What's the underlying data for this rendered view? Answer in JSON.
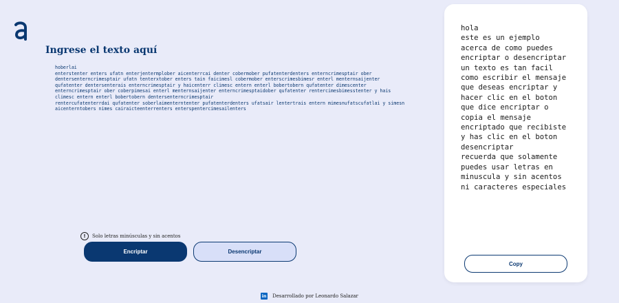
{
  "header": {
    "title": "Ingrese el texto aquí"
  },
  "input": {
    "value": "hoberlai\nenterstenter enters ufatn enterjentermplober aicenterrcai denter cobermober pufatenterdenters enterncrimesptair ober dentersenterncrimesptair ufatn tenterxtober enters tain faicimesl cobermober enterscrimesbimesr enterl menternsaijenter qufatenter dentersenterais enterncrimesptair y haicenterr climesc entern enterl bobertobern qufatenter dimescenter enterncrimesptair ober coberpimesai enterl menternsaijenter enterncrimesptaidober qufatenter rentercimesbimesstenter y hais climesc entern enterl bobertobern dentersenterncrimesptair\nrentercufatenterrdai qufatenter soberlaimenterntenter pufatenterdenters ufatsair lentertrais entern mimesnufatscufatlai y simesn aicenterntobers nimes cairaicteenterrenters enterspentercimesailenters"
  },
  "hint": {
    "icon": "info-icon",
    "glyph": "!",
    "text": "Solo letras minúsculas y sin acentos"
  },
  "buttons": {
    "encrypt_label": "Encriptar",
    "decrypt_label": "Desencriptar",
    "copy_label": "Copy"
  },
  "output": {
    "text": "hola\neste es un ejemplo\nacerca de como puedes\nencriptar o desencriptar\nun texto es tan facil\ncomo escribir el mensaje\nque deseas encriptar y\nhacer clic en el boton\nque dice encriptar o\ncopia el mensaje\nencriptado que recibiste\ny has clic en el boton\ndesencriptar\nrecuerda que solamente\npuedes usar letras en\nminuscula y sin acentos\nni caracteres especiales"
  },
  "footer": {
    "icon": "linkedin-icon",
    "glyph": "in",
    "text": "Desarrollado por Leonardo Salazar"
  },
  "colors": {
    "background": "#e9ebf9",
    "primary": "#0a3871",
    "panel": "#ffffff",
    "linkedin": "#0a66c2"
  }
}
